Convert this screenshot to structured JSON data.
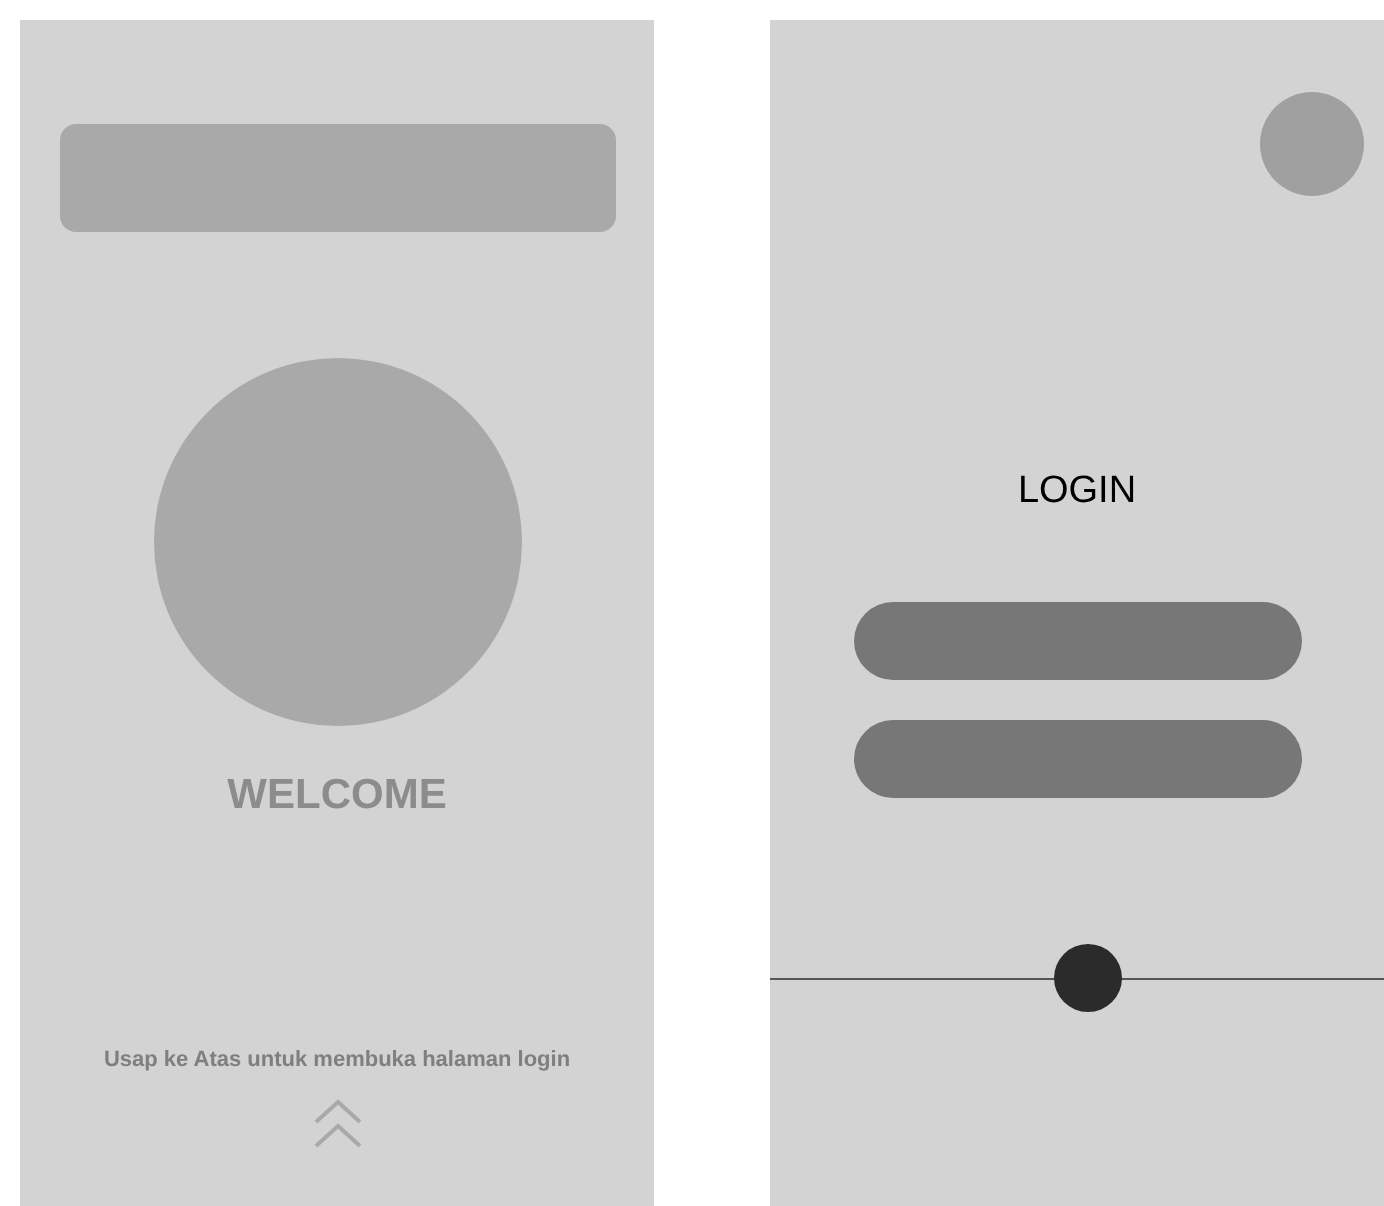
{
  "welcome_screen": {
    "title": "WELCOME",
    "hint": "Usap ke Atas untuk membuka halaman login"
  },
  "login_screen": {
    "title": "LOGIN"
  }
}
